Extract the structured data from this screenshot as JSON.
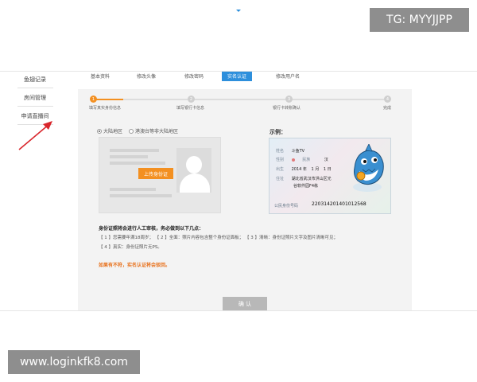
{
  "watermarks": {
    "tg": "TG: MYYJJPP",
    "url": "www.loginkfk8.com"
  },
  "sidebar": {
    "items": [
      {
        "label": "鱼翅记录"
      },
      {
        "label": "房间管理"
      },
      {
        "label": "申请直播间"
      }
    ]
  },
  "tabs": [
    {
      "label": "基本资料"
    },
    {
      "label": "修改头像"
    },
    {
      "label": "修改密码"
    },
    {
      "label": "实名认证",
      "active": true
    },
    {
      "label": "修改用户名"
    }
  ],
  "steps": [
    {
      "num": "1",
      "label": "填写真实身份信息"
    },
    {
      "num": "2",
      "label": "填写银行卡信息"
    },
    {
      "num": "3",
      "label": "银行卡转账确认"
    },
    {
      "num": "4",
      "label": "完成"
    }
  ],
  "steps_completed": 1,
  "region": {
    "mainland": "大陆地区",
    "other": "港澳台等非大陆地区",
    "selected": "mainland"
  },
  "upload_button": "上传身份证",
  "example": {
    "label": "示例：",
    "name_key": "姓名",
    "name": "斗鱼TV",
    "gender_key": "性别",
    "ethnicity_key": "民族",
    "ethnicity": "汉",
    "birth_key": "出生",
    "birth_year": "2014",
    "birth_year_unit": "年",
    "birth_month": "1",
    "birth_month_unit": "月",
    "birth_day": "1",
    "birth_day_unit": "日",
    "address_key": "住址",
    "address_1": "湖北省武汉市洪山区光",
    "address_2": "谷软件园F4栋",
    "id_key": "公民身份号码",
    "id_number": "220314201401012568"
  },
  "notice": {
    "title": "身份证照将会进行人工审核，务必做到以下几点：",
    "line1": "【 1 】您需要年满18周岁； 【 2 】全面：照片内容包含整个身份证面板； 【 3 】清晰：身份证照片文字及图片清晰可见；",
    "line2": "【 4 】真实：身份证照片无PS。",
    "warning": "如果有不符，实名认证将会驳回。"
  },
  "confirm_button": "确 认",
  "colors": {
    "accent": "#2d8fdc",
    "orange": "#f39021",
    "annotation": "#d9262c"
  }
}
